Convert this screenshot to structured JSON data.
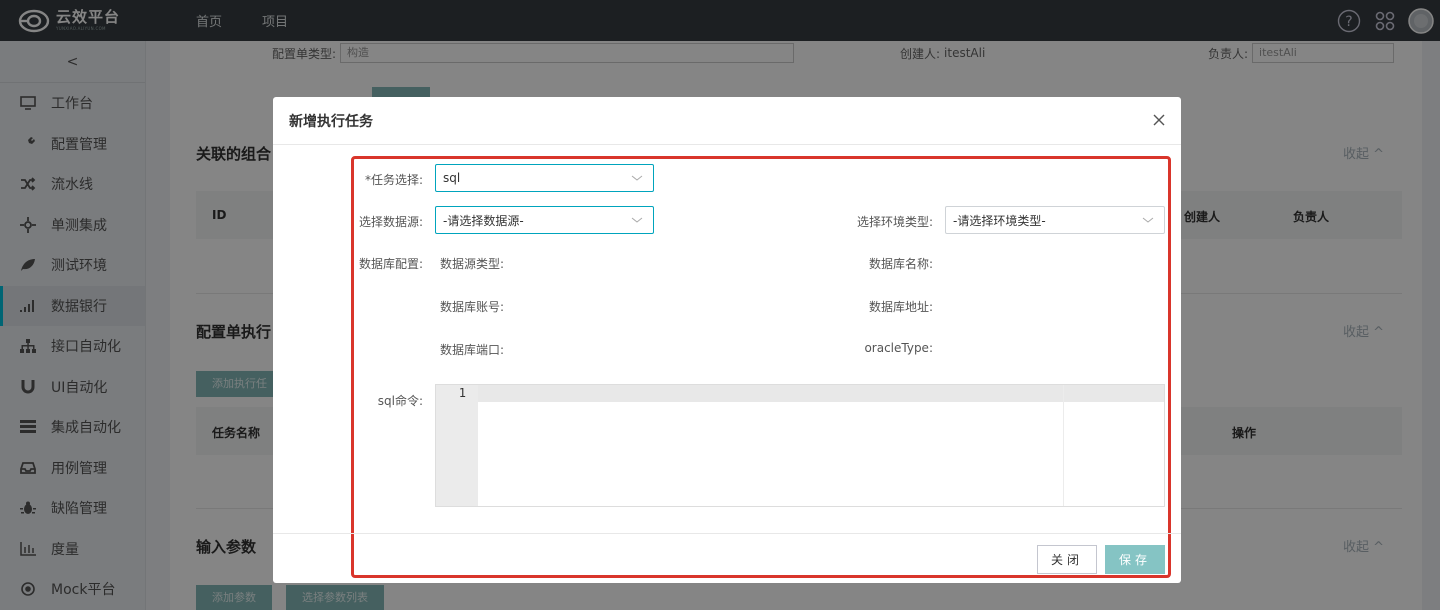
{
  "app": {
    "logo_text": "云效平台",
    "logo_subtext": "YUNXIAO.ALIYUN.COM"
  },
  "nav": [
    "首页",
    "项目"
  ],
  "sidebar": {
    "collapse_glyph": "<",
    "items": [
      {
        "label": "工作台",
        "icon": "monitor-icon"
      },
      {
        "label": "配置管理",
        "icon": "wrench-icon"
      },
      {
        "label": "流水线",
        "icon": "shuffle-icon"
      },
      {
        "label": "单测集成",
        "icon": "crosshair-icon"
      },
      {
        "label": "测试环境",
        "icon": "leaf-icon"
      },
      {
        "label": "数据银行",
        "icon": "bar-chart-icon",
        "active": true
      },
      {
        "label": "接口自动化",
        "icon": "sitemap-icon"
      },
      {
        "label": "UI自动化",
        "icon": "magnet-icon"
      },
      {
        "label": "集成自动化",
        "icon": "server-icon"
      },
      {
        "label": "用例管理",
        "icon": "inbox-icon"
      },
      {
        "label": "缺陷管理",
        "icon": "bug-icon"
      },
      {
        "label": "度量",
        "icon": "column-chart-icon"
      },
      {
        "label": "Mock平台",
        "icon": "target-icon"
      }
    ]
  },
  "background": {
    "config_type_label": "配置单类型:",
    "config_type_value": "构造",
    "creator_label": "创建人:",
    "creator_value": "itestAli",
    "owner_label": "负责人:",
    "owner_value": "itestAli",
    "section1_title": "关联的组合",
    "section1_collapse": "收起 ^",
    "table1_headers": {
      "id": "ID",
      "creator": "创建人",
      "owner": "负责人"
    },
    "section2_title": "配置单执行",
    "section2_collapse": "收起 ^",
    "add_task_button": "添加执行任",
    "table2_headers": {
      "name": "任务名称",
      "action": "操作"
    },
    "section3_title": "输入参数",
    "section3_collapse": "收起 ^",
    "add_param_button": "添加参数",
    "select_param_button": "选择参数列表"
  },
  "modal": {
    "title": "新增执行任务",
    "task_select": {
      "label": "*任务选择:",
      "value": "sql"
    },
    "datasource": {
      "label": "选择数据源:",
      "placeholder": "-请选择数据源-"
    },
    "env_type": {
      "label": "选择环境类型:",
      "placeholder": "-请选择环境类型-"
    },
    "db_config_label": "数据库配置:",
    "db_fields": {
      "source_type": "数据源类型:",
      "db_name": "数据库名称:",
      "account": "数据库账号:",
      "address": "数据库地址:",
      "port": "数据库端口:",
      "oracle_type": "oracleType:"
    },
    "sql_label": "sql命令:",
    "editor_line_number": "1",
    "close_button": "关闭",
    "save_button": "保存"
  }
}
